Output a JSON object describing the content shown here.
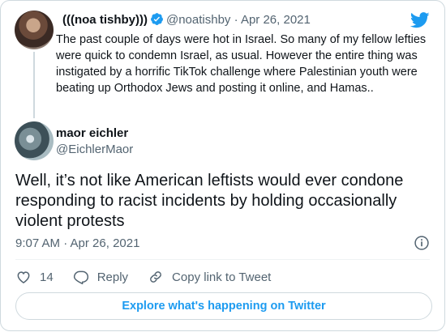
{
  "colors": {
    "accent": "#1d9bf0",
    "text": "#0f1419",
    "muted": "#536471",
    "border": "#cfd9de"
  },
  "parent_tweet": {
    "display_name": "(((noa tishby)))",
    "handle": "@noatishby",
    "separator": "·",
    "date": "Apr 26, 2021",
    "text": "The past couple of days were hot in Israel. So many of my fellow lefties were quick to condemn Israel, as usual. However the entire thing was instigated by a horrific TikTok challenge where Palestinian youth were beating up Orthodox Jews and posting it online, and Hamas..",
    "verified_icon": "verified-badge-icon"
  },
  "main_tweet": {
    "display_name": "maor eichler",
    "handle": "@EichlerMaor",
    "text": "Well, it’s not like American leftists would ever condone responding to racist incidents by holding occasionally violent protests",
    "timestamp": "9:07 AM · Apr 26, 2021"
  },
  "actions": {
    "like_count": "14",
    "reply_label": "Reply",
    "copy_label": "Copy link to Tweet"
  },
  "explore_label": "Explore what's happening on Twitter",
  "icons": [
    "twitter-bird-icon",
    "verified-badge-icon",
    "info-icon",
    "heart-icon",
    "reply-icon",
    "link-icon"
  ]
}
